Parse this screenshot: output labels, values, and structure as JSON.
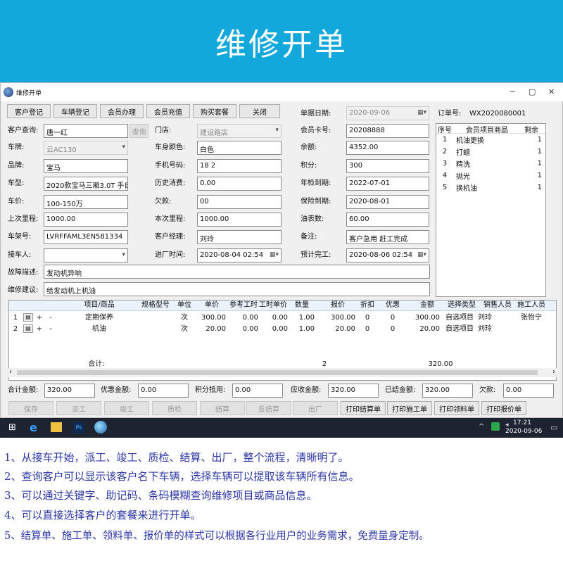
{
  "banner": {
    "title": "维修开单"
  },
  "window": {
    "title": "维修开单",
    "minimize": "─",
    "maximize": "▢",
    "close": "✕"
  },
  "toolbar": [
    "客户登记",
    "车辆登记",
    "会员办理",
    "会员充值",
    "购买套餐",
    "关闭"
  ],
  "form": {
    "customer_label": "客户查询:",
    "customer_value": "唐一红",
    "query_button": "查询",
    "plate_label": "车牌:",
    "plate_value": "云AC130",
    "brand_label": "品牌:",
    "brand_value": "宝马",
    "model_label": "车型:",
    "model_value": "2020款宝马三厢3.0T 手自",
    "price_label": "车价:",
    "price_value": "100-150万",
    "last_mileage_label": "上次里程:",
    "last_mileage_value": "1000.00",
    "vin_label": "车架号:",
    "vin_value": "LVRFFAML3EN581334",
    "receiver_label": "接车人:",
    "receiver_value": "",
    "store_label": "门店:",
    "store_value": "建设路店",
    "color_label": "车身颜色:",
    "color_value": "白色",
    "phone_label": "手机号码:",
    "phone_value": "18        2",
    "history_label": "历史消费:",
    "history_value": "0.00",
    "debt_label": "欠款:",
    "debt_value": "    00",
    "mileage_label": "本次里程:",
    "mileage_value": "1000.00",
    "manager_label": "客户经理:",
    "manager_value": "刘玲",
    "entry_label": "进厂时间:",
    "entry_value": "2020-08-04 02:54",
    "bill_date_label": "单据日期:",
    "bill_date_value": "2020-09-06",
    "order_no_label": "订单号:",
    "order_no_value": "WX2020080001",
    "card_label": "会员卡号:",
    "card_value": "20208888",
    "balance_label": "余额:",
    "balance_value": "4352.00",
    "points_label": "积分:",
    "points_value": "300",
    "inspect_label": "年检到期:",
    "inspect_value": "2022-07-01",
    "insurance_label": "保险到期:",
    "insurance_value": "2020-08-01",
    "meter_label": "油表数:",
    "meter_value": "60.00",
    "remark_label": "备注:",
    "remark_value": "客户急用 赶工完成",
    "finish_label": "预计完工:",
    "finish_value": "2020-08-06 02:54",
    "fault_label": "故障描述:",
    "fault_value": "发动机异响",
    "suggest_label": "维修建议:",
    "suggest_value": "给发动机上机油"
  },
  "package_list": {
    "headers": [
      "序号",
      "会员项目商品",
      "剩余"
    ],
    "rows": [
      [
        "1",
        "机油更换",
        "1"
      ],
      [
        "2",
        "打蜡",
        "1"
      ],
      [
        "3",
        "精洗",
        "1"
      ],
      [
        "4",
        "抛光",
        "1"
      ],
      [
        "5",
        "换机油",
        "1"
      ]
    ]
  },
  "items_grid": {
    "headers": [
      "项目/商品",
      "规格型号",
      "单位",
      "单价",
      "参考工时",
      "工时单价",
      "数量",
      "报价",
      "折扣",
      "优惠",
      "金额",
      "选择类型",
      "销售人员",
      "施工人员"
    ],
    "rows": [
      {
        "no": "1",
        "add": "+",
        "del": "-",
        "cells": [
          "定期保养",
          "",
          "次",
          "300.00",
          "0.00",
          "0.00",
          "1.00",
          "300.00",
          "0",
          "0",
          "300.00",
          "自选项目",
          "刘玲",
          "张怡宁"
        ]
      },
      {
        "no": "2",
        "add": "+",
        "del": "-",
        "cells": [
          "机油",
          "",
          "次",
          "20.00",
          "0.00",
          "0.00",
          "1.00",
          "20.00",
          "0",
          "0",
          "20.00",
          "自选项目",
          "刘玲",
          ""
        ]
      }
    ],
    "total_label": "合计:",
    "total_qty": "2",
    "total_amount": "320.00"
  },
  "totals": {
    "sum_label": "合计金额:",
    "sum_value": "320.00",
    "discount_label": "优惠金额:",
    "discount_value": "0.00",
    "points_label": "积分抵用:",
    "points_value": "0.00",
    "receivable_label": "应收金额:",
    "receivable_value": "320.00",
    "settled_label": "已结金额:",
    "settled_value": "320.00",
    "owed_label": "欠款:",
    "owed_value": "0.00"
  },
  "actions": [
    "保存",
    "派工",
    "竣工",
    "质检",
    "结算",
    "反结算",
    "出厂",
    "打印结算单",
    "打印施工单",
    "打印领料单",
    "打印报价单"
  ],
  "taskbar": {
    "time": "17:21",
    "date": "2020-09-06"
  },
  "descriptions": [
    "1、从接车开始，派工、竣工、质检、结算、出厂，整个流程，清晰明了。",
    "2、查询客户可以显示该客户名下车辆，选择车辆可以提取该车辆所有信息。",
    "3、可以通过关键字、助记码、条码模糊查询维修项目或商品信息。",
    "4、可以直接选择客户的套餐来进行开单。",
    "5、结算单、施工单、领料单、报价单的样式可以根据各行业用户的业务需求，免费量身定制。"
  ],
  "colors": {
    "banner": "#12a8dc",
    "description_text": "#2c37a8",
    "taskbar": "#1d2330"
  }
}
